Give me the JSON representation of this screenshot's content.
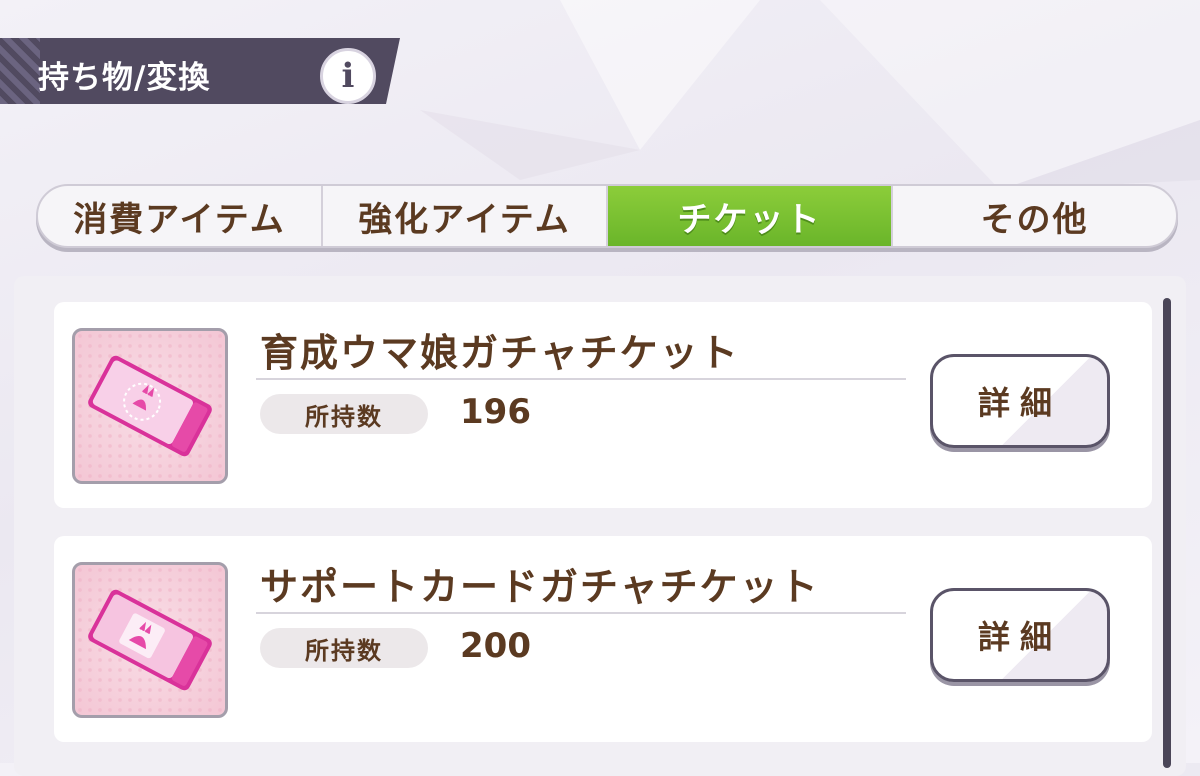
{
  "header": {
    "title": "持ち物/変換",
    "info_label": "i"
  },
  "tabs": [
    {
      "label": "消費アイテム",
      "active": false
    },
    {
      "label": "強化アイテム",
      "active": false
    },
    {
      "label": "チケット",
      "active": true
    },
    {
      "label": "その他",
      "active": false
    }
  ],
  "items": [
    {
      "name": "育成ウマ娘ガチャチケット",
      "qty_label": "所持数",
      "qty_value": "196",
      "detail_label": "詳細",
      "icon": "training-gacha-ticket-icon"
    },
    {
      "name": "サポートカードガチャチケット",
      "qty_label": "所持数",
      "qty_value": "200",
      "detail_label": "詳細",
      "icon": "support-card-gacha-ticket-icon"
    }
  ],
  "colors": {
    "accent_active_tab": "#7cc434",
    "text_brown": "#5b3a21",
    "header_bg": "#514a60",
    "ticket_pink": "#e64a9a"
  }
}
